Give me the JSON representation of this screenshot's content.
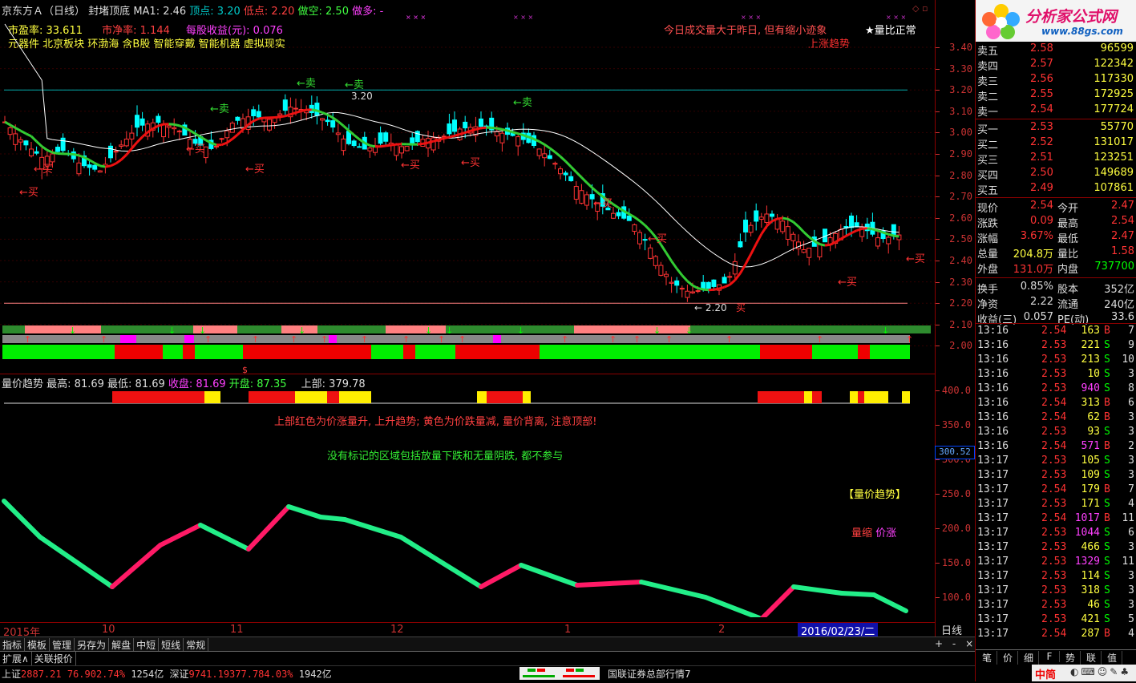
{
  "header": {
    "stock": "京东方Ａ（日线）",
    "indicator_name": "封堵顶底",
    "ma1": "MA1: 2.46",
    "top": "顶点: 3.20",
    "low": "低点: 2.20",
    "short": "做空: 2.50",
    "more": "做多: -",
    "pe": "市盈率: 33.611",
    "pb": "市净率: 1.144",
    "eps": "每股收益(元): 0.076",
    "sectors": "元器件 北京板块 环渤海 含B股 智能穿戴 智能机器 虚拟现实",
    "note1": "今日成交量大于昨日, 但有缩小迹象",
    "note2": "★量比正常",
    "note3": "上涨趋势"
  },
  "price_axis": [
    "3.40",
    "3.30",
    "3.20",
    "3.10",
    "3.00",
    "2.90",
    "2.80",
    "2.70",
    "2.60",
    "2.50",
    "2.40",
    "2.30",
    "2.20",
    "2.10",
    "2.00"
  ],
  "chart_labels": {
    "sell": "←卖",
    "buy": "←买",
    "high_mark": "3.20",
    "low_mark": "← 2.20",
    "buy_low": "买"
  },
  "lower_panel": {
    "title": "量价趋势",
    "max": "最高: 81.69",
    "min": "最低: 81.69",
    "close": "收盘: 81.69",
    "open": "开盘: 87.35",
    "upper": "上部: 379.78",
    "text1": "上部红色为价涨量升, 上升趋势; 黄色为价跌量减, 量价背离, 注意顶部!",
    "text2": "没有标记的区域包括放量下跌和无量阴跌, 都不参与",
    "legend_title": "【量价趋势】",
    "legend_a": "量缩",
    "legend_b": "价涨",
    "axis": [
      "400.0",
      "350.0",
      "300.0",
      "250.0",
      "200.0",
      "150.0",
      "100.0"
    ],
    "current": "300.52",
    "dollar": "$"
  },
  "time_axis": {
    "labels": [
      "2015年",
      "10",
      "11",
      "12",
      "1",
      "2"
    ],
    "cursor": "2016/02/23/二",
    "period": "日线"
  },
  "toolbar": [
    "指标",
    "模板",
    "管理",
    "另存为",
    "解盘",
    "中短",
    "短线",
    "常规"
  ],
  "toolbar_right": [
    "+",
    "-",
    "×"
  ],
  "bottom": {
    "tabs": [
      "扩展∧",
      "关联报价"
    ],
    "sh_label": "上证",
    "sh_value": "2887.21",
    "sh_change": "76.90",
    "sh_pct": "2.74%",
    "sh_amount": "1254亿",
    "sz_label": "深证",
    "sz_value": "9741.19",
    "sz_change": "377.78",
    "sz_pct": "4.03%",
    "sz_amount": "1942亿",
    "server": "国联证券总部行情7"
  },
  "logo": {
    "title": "分析家公式网",
    "url": "www.88gs.com"
  },
  "orderbook": {
    "asks": [
      {
        "label": "卖五",
        "price": "2.58",
        "vol": "96599"
      },
      {
        "label": "卖四",
        "price": "2.57",
        "vol": "122342"
      },
      {
        "label": "卖三",
        "price": "2.56",
        "vol": "117330"
      },
      {
        "label": "卖二",
        "price": "2.55",
        "vol": "172925"
      },
      {
        "label": "卖一",
        "price": "2.54",
        "vol": "177724"
      }
    ],
    "bids": [
      {
        "label": "买一",
        "price": "2.53",
        "vol": "55770"
      },
      {
        "label": "买二",
        "price": "2.52",
        "vol": "131017"
      },
      {
        "label": "买三",
        "price": "2.51",
        "vol": "123251"
      },
      {
        "label": "买四",
        "price": "2.50",
        "vol": "149689"
      },
      {
        "label": "买五",
        "price": "2.49",
        "vol": "107861"
      }
    ]
  },
  "quote": [
    {
      "l1": "现价",
      "v1": "2.54",
      "l2": "今开",
      "v2": "2.47"
    },
    {
      "l1": "涨跌",
      "v1": "0.09",
      "l2": "最高",
      "v2": "2.54"
    },
    {
      "l1": "涨幅",
      "v1": "3.67%",
      "l2": "最低",
      "v2": "2.47"
    },
    {
      "l1": "总量",
      "v1": "204.8万",
      "l2": "量比",
      "v2": "1.58"
    },
    {
      "l1": "外盘",
      "v1": "131.0万",
      "l2": "内盘",
      "v2": "737700"
    },
    {
      "l1": "换手",
      "v1": "0.85%",
      "l2": "股本",
      "v2": "352亿"
    },
    {
      "l1": "净资",
      "v1": "2.22",
      "l2": "流通",
      "v2": "240亿"
    },
    {
      "l1": "收益(三)",
      "v1": "0.057",
      "l2": "PE(动)",
      "v2": "33.6"
    }
  ],
  "ticks": [
    {
      "t": "13:16",
      "p": "2.54",
      "v": "163",
      "s": "B",
      "n": "7"
    },
    {
      "t": "13:16",
      "p": "2.53",
      "v": "221",
      "s": "S",
      "n": "9"
    },
    {
      "t": "13:16",
      "p": "2.53",
      "v": "213",
      "s": "S",
      "n": "10"
    },
    {
      "t": "13:16",
      "p": "2.53",
      "v": "10",
      "s": "S",
      "n": "3"
    },
    {
      "t": "13:16",
      "p": "2.53",
      "v": "940",
      "s": "S",
      "n": "8"
    },
    {
      "t": "13:16",
      "p": "2.54",
      "v": "313",
      "s": "B",
      "n": "6"
    },
    {
      "t": "13:16",
      "p": "2.54",
      "v": "62",
      "s": "B",
      "n": "3"
    },
    {
      "t": "13:16",
      "p": "2.53",
      "v": "93",
      "s": "S",
      "n": "3"
    },
    {
      "t": "13:16",
      "p": "2.54",
      "v": "571",
      "s": "B",
      "n": "2"
    },
    {
      "t": "13:17",
      "p": "2.53",
      "v": "105",
      "s": "S",
      "n": "3"
    },
    {
      "t": "13:17",
      "p": "2.53",
      "v": "109",
      "s": "S",
      "n": "3"
    },
    {
      "t": "13:17",
      "p": "2.54",
      "v": "179",
      "s": "B",
      "n": "7"
    },
    {
      "t": "13:17",
      "p": "2.53",
      "v": "171",
      "s": "S",
      "n": "4"
    },
    {
      "t": "13:17",
      "p": "2.54",
      "v": "1017",
      "s": "B",
      "n": "11"
    },
    {
      "t": "13:17",
      "p": "2.53",
      "v": "1044",
      "s": "S",
      "n": "6"
    },
    {
      "t": "13:17",
      "p": "2.53",
      "v": "466",
      "s": "S",
      "n": "3"
    },
    {
      "t": "13:17",
      "p": "2.53",
      "v": "1329",
      "s": "S",
      "n": "11"
    },
    {
      "t": "13:17",
      "p": "2.53",
      "v": "114",
      "s": "S",
      "n": "3"
    },
    {
      "t": "13:17",
      "p": "2.53",
      "v": "318",
      "s": "S",
      "n": "3"
    },
    {
      "t": "13:17",
      "p": "2.53",
      "v": "46",
      "s": "S",
      "n": "3"
    },
    {
      "t": "13:17",
      "p": "2.53",
      "v": "421",
      "s": "S",
      "n": "5"
    },
    {
      "t": "13:17",
      "p": "2.54",
      "v": "287",
      "s": "B",
      "n": "4"
    }
  ],
  "right_tabs": [
    "笔",
    "价",
    "细",
    "F",
    "势",
    "联",
    "值",
    "中简"
  ],
  "colors": {
    "up": "#ff3333",
    "down": "#00ffff",
    "ma": "#ffffff",
    "trend_green": "#33cc33",
    "trend_red": "#ee1111",
    "pink": "#ff8080",
    "accent": "#ff4444"
  }
}
